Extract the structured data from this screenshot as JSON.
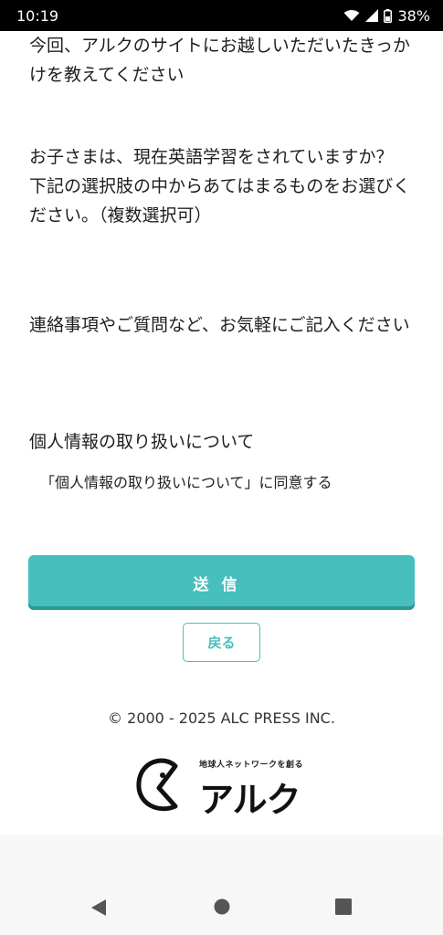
{
  "status_bar": {
    "time": "10:19",
    "battery": "38%",
    "icons": [
      "wifi-icon",
      "signal-icon",
      "battery-icon"
    ]
  },
  "form": {
    "q1": "今回、アルクのサイトにお越しいただいたきっかけを教えてください",
    "q2_line1": "お子さまは、現在英語学習をされていますか？",
    "q2_line2": "下記の選択肢の中からあてはまるものをお選びください。（複数選択可）",
    "q3": "連絡事項やご質問など、お気軽にご記入ください",
    "q4": "個人情報の取り扱いについて",
    "consent_label": "「個人情報の取り扱いについて」に同意する"
  },
  "buttons": {
    "submit_label": "送信",
    "back_label": "戻る"
  },
  "footer": {
    "copyright": "© 2000 - 2025 ALC PRESS INC.",
    "logo_tagline": "地球人ネットワークを創る",
    "logo_text": "アルク"
  },
  "colors": {
    "accent": "#46bfbd",
    "accent_dark": "#2d9896"
  },
  "nav": {
    "icons": [
      "back-triangle-icon",
      "home-circle-icon",
      "recents-square-icon"
    ]
  }
}
